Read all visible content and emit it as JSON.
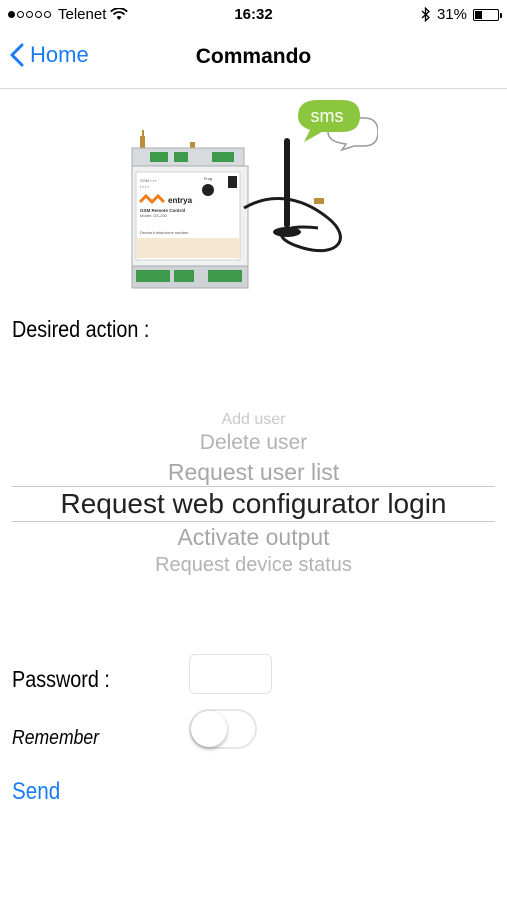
{
  "status_bar": {
    "signal_dots": [
      true,
      false,
      false,
      false,
      false
    ],
    "carrier": "Telenet",
    "time": "16:32",
    "battery_percent": "31%",
    "battery_level": 0.31
  },
  "nav": {
    "back_label": "Home",
    "title": "Commando"
  },
  "device_image": {
    "sms_label": "sms",
    "brand": "entrya",
    "model_line": "GSM Remote Control",
    "model_number": "Model: GS-200",
    "phone_label": "Device's telephone number",
    "prog_label": "Prog"
  },
  "form": {
    "desired_action_label": "Desired action :",
    "actions": [
      "Add user",
      "Delete user",
      "Request user list",
      "Request web configurator login",
      "Activate output",
      "Request device status"
    ],
    "selected_action": "Request web configurator login",
    "password_label": "Password :",
    "password_value": "",
    "remember_label": "Remember",
    "remember_on": false,
    "send_label": "Send"
  },
  "colors": {
    "accent": "#1a7cf2",
    "sms_bubble": "#8cc63f"
  }
}
